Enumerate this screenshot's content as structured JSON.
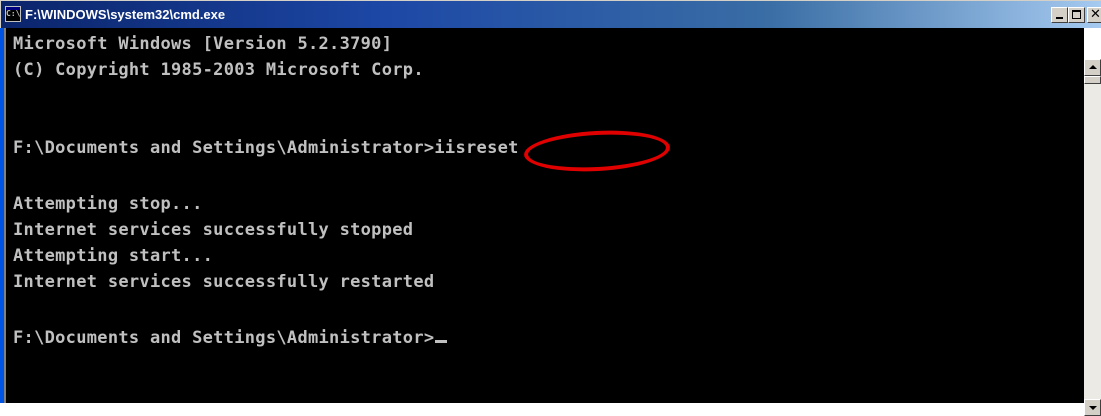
{
  "window": {
    "title": "F:\\WINDOWS\\system32\\cmd.exe",
    "icon": "cmd-icon",
    "icon_text": "C:\\"
  },
  "console": {
    "lines": [
      "Microsoft Windows [Version 5.2.3790]",
      "(C) Copyright 1985-2003 Microsoft Corp.",
      "",
      "F:\\Documents and Settings\\Administrator>iisreset",
      "",
      "Attempting stop...",
      "Internet services successfully stopped",
      "Attempting start...",
      "Internet services successfully restarted",
      "",
      "F:\\Documents and Settings\\Administrator>"
    ]
  },
  "colors": {
    "console_background": "#000000",
    "console_text": "#c0c0c0",
    "highlight": "#e10000",
    "titlebar_start": "#0a246a",
    "titlebar_end": "#a6caf0"
  }
}
